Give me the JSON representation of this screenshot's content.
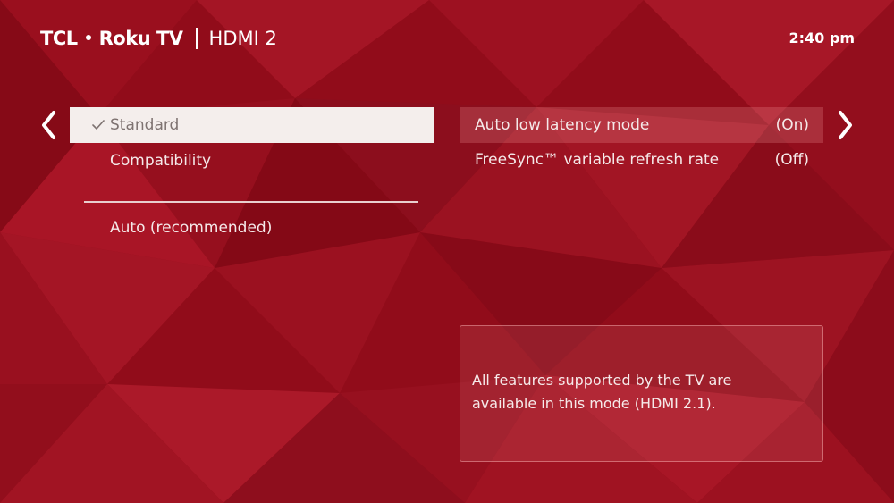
{
  "header": {
    "brand_tcl": "TCL",
    "brand_roku": "Roku TV",
    "source": "HDMI 2",
    "time": "2:40 pm"
  },
  "nav": {
    "left_arrow_icon": "chevron-left-icon",
    "right_arrow_icon": "chevron-right-icon"
  },
  "modes": {
    "items": [
      {
        "label": "Standard",
        "checked": true,
        "selected": true
      },
      {
        "label": "Compatibility",
        "checked": false,
        "selected": false
      }
    ],
    "auto_label": "Auto (recommended)"
  },
  "features": {
    "items": [
      {
        "label": "Auto low latency mode",
        "value": "(On)"
      },
      {
        "label": "FreeSync™ variable refresh rate",
        "value": "(Off)"
      }
    ]
  },
  "info": {
    "text_line1": "All features supported by the TV are",
    "text_line2": "available in this mode (HDMI 2.1)."
  },
  "colors": {
    "background": "#9c0f1e",
    "selected_bg": "#f4eeec",
    "selected_text": "#7e7371",
    "text": "#f5e9e9"
  }
}
